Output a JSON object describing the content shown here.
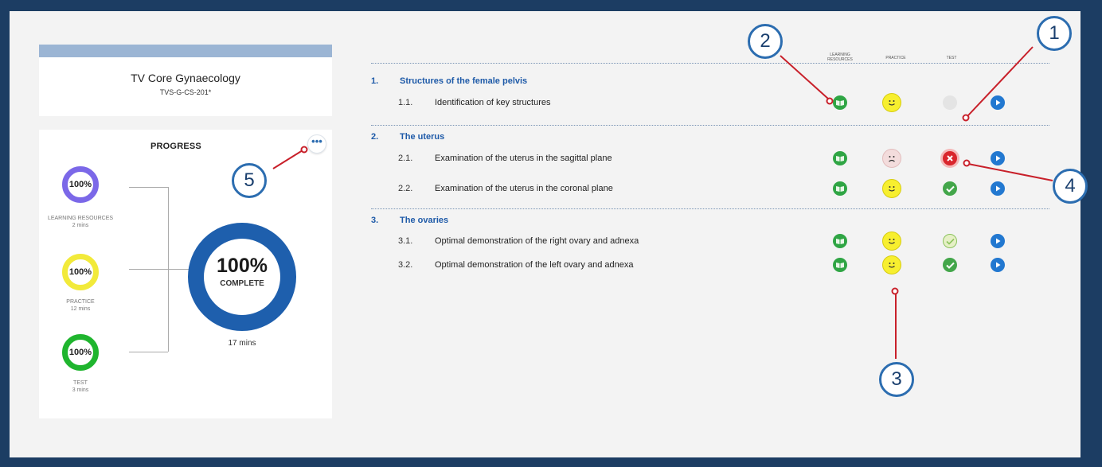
{
  "course": {
    "title": "TV Core Gynaecology",
    "code": "TVS-G-CS-201*"
  },
  "progress": {
    "heading": "PROGRESS",
    "more_label": "•••",
    "learning_resources": {
      "percent": "100%",
      "label": "LEARNING RESOURCES",
      "time": "2 mins"
    },
    "practice": {
      "percent": "100%",
      "label": "PRACTICE",
      "time": "12 mins"
    },
    "test": {
      "percent": "100%",
      "label": "TEST",
      "time": "3 mins"
    },
    "overall": {
      "percent": "100%",
      "label": "COMPLETE",
      "time": "17 mins"
    }
  },
  "columns": {
    "learning_resources": "LEARNING RESOURCES",
    "practice": "PRACTICE",
    "test": "TEST"
  },
  "sections": [
    {
      "number": "1.",
      "title": "Structures of the female pelvis",
      "items": [
        {
          "number": "1.1.",
          "title": "Identification of key structures",
          "learning": "book-icon",
          "practice": "smiley-happy-icon",
          "test": "test-not-started-icon"
        }
      ]
    },
    {
      "number": "2.",
      "title": "The uterus",
      "items": [
        {
          "number": "2.1.",
          "title": "Examination of the uterus in the sagittal plane",
          "learning": "book-icon",
          "practice": "smiley-sad-icon",
          "test": "test-failed-icon"
        },
        {
          "number": "2.2.",
          "title": "Examination of the uterus in the coronal plane",
          "learning": "book-icon",
          "practice": "smiley-happy-icon",
          "test": "test-passed-icon"
        }
      ]
    },
    {
      "number": "3.",
      "title": "The ovaries",
      "items": [
        {
          "number": "3.1.",
          "title": "Optimal demonstration of the right ovary and adnexa",
          "learning": "book-icon",
          "practice": "smiley-happy-icon",
          "test": "test-passed-light-icon"
        },
        {
          "number": "3.2.",
          "title": "Optimal demonstration of the left ovary and adnexa",
          "learning": "book-icon",
          "practice": "smiley-happy-icon",
          "test": "test-passed-icon"
        }
      ]
    }
  ],
  "callouts": [
    "1",
    "2",
    "3",
    "4",
    "5"
  ],
  "colors": {
    "frame": "#1c3d63",
    "accent_blue": "#1e5aa8",
    "learning_ring": "#7b68e8",
    "practice_ring": "#f2ea3a",
    "test_ring": "#1fb52e",
    "overall_ring": "#1e5fad",
    "callout_leader": "#c8202a"
  }
}
